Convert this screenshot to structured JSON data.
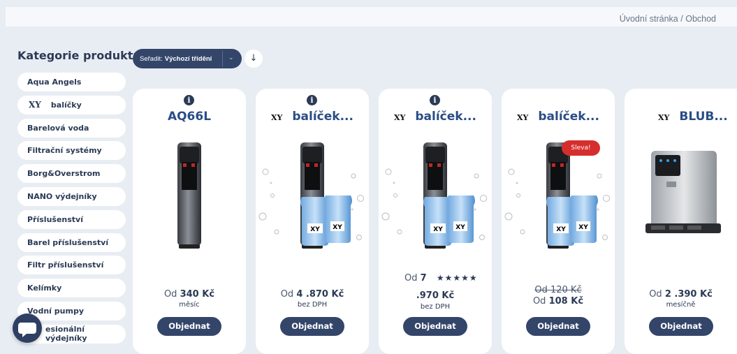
{
  "breadcrumb": {
    "home": "Úvodní stránka",
    "separator": "/",
    "current": "Obchod"
  },
  "sidebar": {
    "title": "Kategorie produktu",
    "items": [
      {
        "label": "Aqua Angels"
      },
      {
        "label": "balíčky",
        "logo": "XY"
      },
      {
        "label": "Barelová voda"
      },
      {
        "label": "Filtrační systémy"
      },
      {
        "label": "Borg&Overstrom"
      },
      {
        "label": "NANO výdejníky"
      },
      {
        "label": "Příslušenství"
      },
      {
        "label": "Barel příslušenství"
      },
      {
        "label": "Filtr příslušenství"
      },
      {
        "label": "Kelímky"
      },
      {
        "label": "Vodní pumpy"
      },
      {
        "label": "esionální výdejníky"
      }
    ]
  },
  "sort": {
    "prefix": "Seřadit:",
    "value": "Výchozí třídění",
    "caret": "⌄",
    "direction_icon": "↓"
  },
  "products": [
    {
      "title": "AQ66L",
      "logo": "",
      "info": "i",
      "price_prefix": "Od",
      "price": "340 Kč",
      "price_sub": "měsíc",
      "button": "Objednat"
    },
    {
      "title": "balíček...",
      "logo": "XY",
      "info": "i",
      "price_prefix": "Od",
      "price": "4 .870 Kč",
      "price_sub": "bez DPH",
      "button": "Objednat"
    },
    {
      "title": "balíček...",
      "logo": "XY",
      "info": "i",
      "price_prefix": "Od",
      "price_part1": "7",
      "stars": "★★★★★",
      "price_part2": ".970 Kč",
      "price_sub": "bez DPH",
      "button": "Objednat"
    },
    {
      "title": "balíček...",
      "logo": "XY",
      "badge": "Sleva!",
      "old_price": "Od 120 Kč",
      "price_prefix": "Od",
      "price": "108 Kč",
      "button": "Objednat"
    },
    {
      "title": "BLUB...",
      "logo": "XY",
      "price_prefix": "Od",
      "price": "2 .390 Kč",
      "price_sub": "mesíčně",
      "button": "Objednat"
    }
  ],
  "bottle_label": "XY",
  "colors": {
    "navy": "#34456a",
    "title_blue": "#2a4d86",
    "sale_red": "#d62e2e",
    "background": "#e8edf3"
  }
}
